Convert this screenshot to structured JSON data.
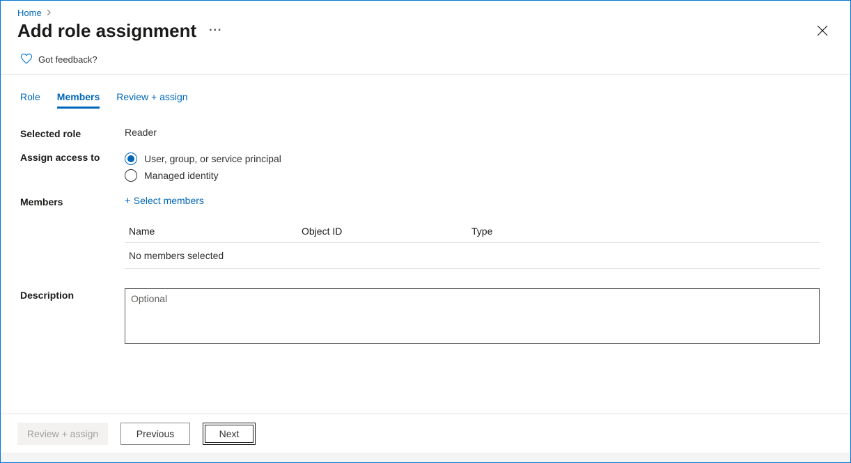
{
  "breadcrumb": {
    "home": "Home"
  },
  "page_title": "Add role assignment",
  "feedback_text": "Got feedback?",
  "tabs": {
    "role": "Role",
    "members": "Members",
    "review": "Review + assign"
  },
  "form": {
    "selected_role_label": "Selected role",
    "selected_role_value": "Reader",
    "assign_access_label": "Assign access to",
    "assign_option_user": "User, group, or service principal",
    "assign_option_managed": "Managed identity",
    "members_label": "Members",
    "select_members_link": "Select members",
    "description_label": "Description",
    "description_placeholder": "Optional"
  },
  "members_table": {
    "col_name": "Name",
    "col_object_id": "Object ID",
    "col_type": "Type",
    "empty_text": "No members selected"
  },
  "footer": {
    "review_assign": "Review + assign",
    "previous": "Previous",
    "next": "Next"
  }
}
